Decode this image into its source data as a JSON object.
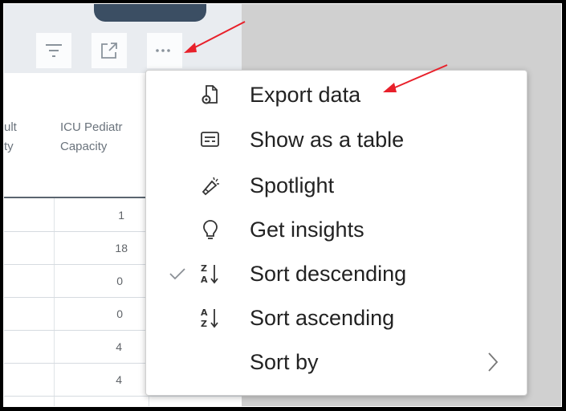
{
  "table": {
    "headers": [
      {
        "text": "ult\nty"
      },
      {
        "text": "ICU Pediatr\nCapacity"
      }
    ],
    "rows": [
      "1",
      "18",
      "0",
      "0",
      "4",
      "4"
    ]
  },
  "toolbar": {
    "filter_icon": "filter-icon",
    "focus_icon": "focus-mode-icon",
    "more_icon": "more-options-icon"
  },
  "menu": {
    "items": [
      {
        "label": "Export data",
        "icon": "export-data-icon"
      },
      {
        "label": "Show as a table",
        "icon": "table-view-icon"
      },
      {
        "label": "Spotlight",
        "icon": "spotlight-icon"
      },
      {
        "label": "Get insights",
        "icon": "lightbulb-icon"
      },
      {
        "label": "Sort descending",
        "icon": "sort-descending-icon",
        "checked": true
      },
      {
        "label": "Sort ascending",
        "icon": "sort-ascending-icon"
      },
      {
        "label": "Sort by",
        "icon": "",
        "submenu": true
      }
    ]
  },
  "colors": {
    "arrow": "#e8202a",
    "canvas": "#d0d0d0",
    "dark_tab": "#3b4e63"
  }
}
